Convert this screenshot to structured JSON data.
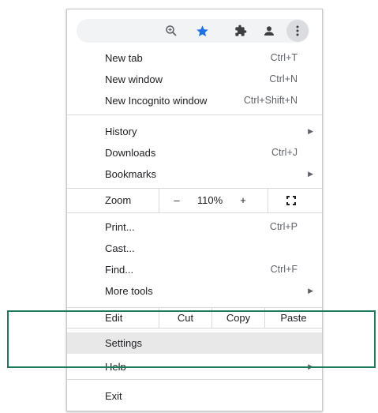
{
  "toolbar": {
    "icons": [
      "zoom-icon",
      "star-icon",
      "extensions-icon",
      "profile-icon",
      "more-icon"
    ],
    "star_color": "#1a73e8"
  },
  "menu": {
    "group1": [
      {
        "label": "New tab",
        "shortcut": "Ctrl+T"
      },
      {
        "label": "New window",
        "shortcut": "Ctrl+N"
      },
      {
        "label": "New Incognito window",
        "shortcut": "Ctrl+Shift+N"
      }
    ],
    "group2": [
      {
        "label": "History",
        "arrow": "▶"
      },
      {
        "label": "Downloads",
        "shortcut": "Ctrl+J"
      },
      {
        "label": "Bookmarks",
        "arrow": "▶"
      }
    ],
    "zoom": {
      "label": "Zoom",
      "minus": "–",
      "level": "110%",
      "plus": "+"
    },
    "group3": [
      {
        "label": "Print...",
        "shortcut": "Ctrl+P"
      },
      {
        "label": "Cast..."
      },
      {
        "label": "Find...",
        "shortcut": "Ctrl+F"
      },
      {
        "label": "More tools",
        "arrow": "▶"
      }
    ],
    "edit": {
      "label": "Edit",
      "cut": "Cut",
      "copy": "Copy",
      "paste": "Paste"
    },
    "group4": [
      {
        "label": "Settings"
      },
      {
        "label": "Help",
        "arrow": "▶"
      }
    ],
    "exit": {
      "label": "Exit"
    }
  },
  "colors": {
    "callout_border": "#1c7a5b",
    "hover_bg": "#e8e8e8"
  }
}
